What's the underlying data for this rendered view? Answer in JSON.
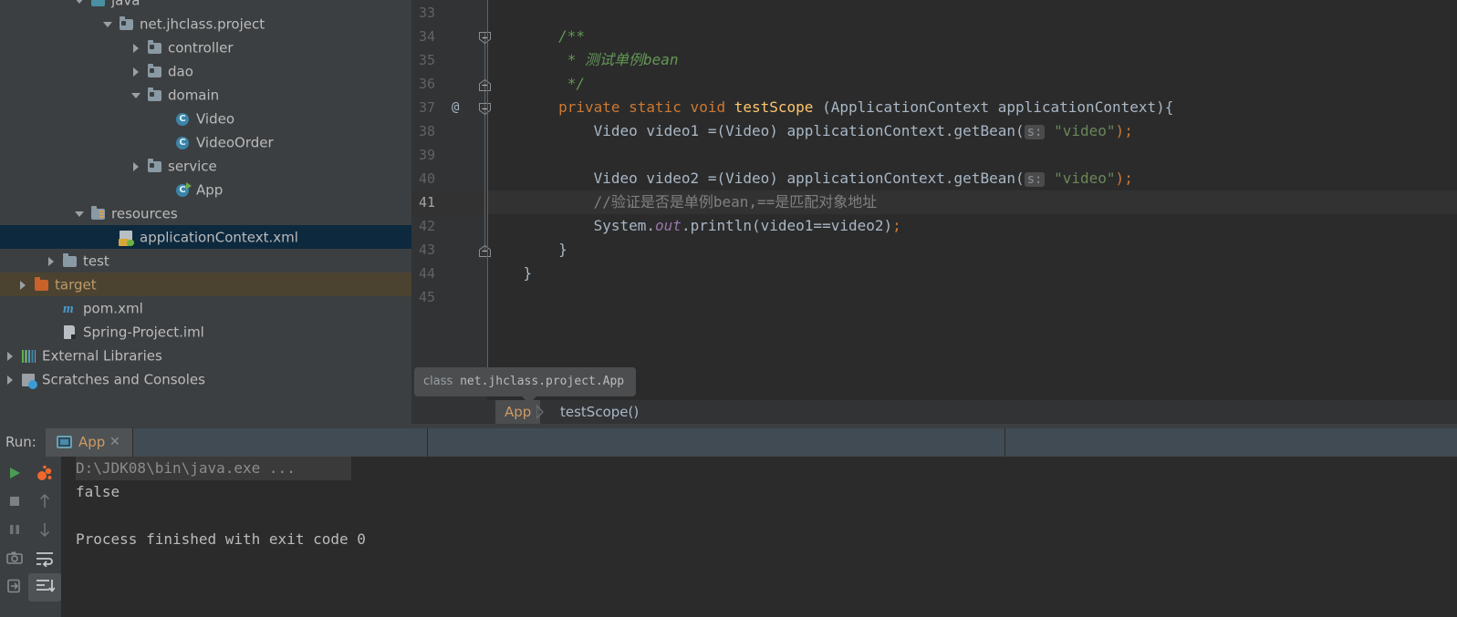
{
  "project_tree": {
    "items": [
      {
        "label": "java",
        "indent": 76,
        "arrow": "open",
        "icon": "source-folder-icon",
        "state": "normal"
      },
      {
        "label": "net.jhclass.project",
        "indent": 107,
        "arrow": "open",
        "icon": "package-folder-icon",
        "state": "normal"
      },
      {
        "label": "controller",
        "indent": 138,
        "arrow": "closed",
        "icon": "package-folder-icon",
        "state": "normal"
      },
      {
        "label": "dao",
        "indent": 138,
        "arrow": "closed",
        "icon": "package-folder-icon",
        "state": "normal"
      },
      {
        "label": "domain",
        "indent": 138,
        "arrow": "open",
        "icon": "package-folder-icon",
        "state": "normal"
      },
      {
        "label": "Video",
        "indent": 169,
        "arrow": "none",
        "icon": "class-icon",
        "state": "normal"
      },
      {
        "label": "VideoOrder",
        "indent": 169,
        "arrow": "none",
        "icon": "class-icon",
        "state": "normal"
      },
      {
        "label": "service",
        "indent": 138,
        "arrow": "closed",
        "icon": "package-folder-icon",
        "state": "normal"
      },
      {
        "label": "App",
        "indent": 169,
        "arrow": "none",
        "icon": "runnable-class-icon",
        "state": "normal"
      },
      {
        "label": "resources",
        "indent": 76,
        "arrow": "open",
        "icon": "resources-folder-icon",
        "state": "normal"
      },
      {
        "label": "applicationContext.xml",
        "indent": 107,
        "arrow": "none",
        "icon": "spring-xml-icon",
        "state": "selected"
      },
      {
        "label": "test",
        "indent": 45,
        "arrow": "closed",
        "icon": "folder-icon",
        "state": "normal"
      },
      {
        "label": "target",
        "indent": 14,
        "arrow": "closed",
        "icon": "excluded-folder-icon",
        "state": "excluded"
      },
      {
        "label": "pom.xml",
        "indent": 45,
        "arrow": "none",
        "icon": "maven-icon",
        "state": "normal"
      },
      {
        "label": "Spring-Project.iml",
        "indent": 45,
        "arrow": "none",
        "icon": "iml-icon",
        "state": "normal"
      },
      {
        "label": "External Libraries",
        "indent": 0,
        "arrow": "closed",
        "icon": "libraries-icon",
        "state": "normal"
      },
      {
        "label": "Scratches and Consoles",
        "indent": 0,
        "arrow": "closed",
        "icon": "scratches-icon",
        "state": "normal"
      }
    ]
  },
  "editor": {
    "first_line_number": 33,
    "last_line_number": 45,
    "current_line": 41,
    "gutter_annotation": "@",
    "lines": [
      {
        "num": 33,
        "html": ""
      },
      {
        "num": 34,
        "html": "        <span class=\"cmd\">/**</span>"
      },
      {
        "num": 35,
        "html": "         <span class=\"cmd\">* 测试单例bean</span>"
      },
      {
        "num": 36,
        "html": "         <span class=\"cmd\">*/</span>"
      },
      {
        "num": 37,
        "html": "        <span class=\"k\">private static void</span> <span class=\"m\">testScope</span> (ApplicationContext applicationContext){"
      },
      {
        "num": 38,
        "html": "            Video video1 =(Video) applicationContext.getBean(<span class=\"hint\">s:</span> <span class=\"s\">\"video\"</span><span class=\"k\">)</span><span class=\"k\">;</span>"
      },
      {
        "num": 39,
        "html": ""
      },
      {
        "num": 40,
        "html": "            Video video2 =(Video) applicationContext.getBean(<span class=\"hint\">s:</span> <span class=\"s\">\"video\"</span><span class=\"k\">)</span><span class=\"k\">;</span>"
      },
      {
        "num": 41,
        "html": "            <span class=\"cm\">//验证是否是单例bean,==是匹配对象地址</span>"
      },
      {
        "num": 42,
        "html": "            System.<span class=\"fi\">out</span>.println(video1==video2)<span class=\"k\">;</span>"
      },
      {
        "num": 43,
        "html": "        }"
      },
      {
        "num": 44,
        "html": "    }"
      },
      {
        "num": 45,
        "html": ""
      }
    ],
    "plain_text_lines": [
      "",
      "    /**",
      "     * 测试单例bean",
      "     */",
      "    private static void testScope (ApplicationContext applicationContext){",
      "        Video video1 =(Video) applicationContext.getBean( s: \"video\");",
      "",
      "        Video video2 =(Video) applicationContext.getBean( s: \"video\");",
      "        //验证是否是单例bean,==是匹配对象地址",
      "        System.out.println(video1==video2);",
      "    }",
      "}",
      ""
    ]
  },
  "tooltip": {
    "keyword": "class",
    "qualified_name": "net.jhclass.project.App"
  },
  "breadcrumb": {
    "items": [
      {
        "label": "App",
        "active": true
      },
      {
        "label": "testScope()",
        "active": false
      }
    ]
  },
  "run_panel": {
    "label": "Run:",
    "tab": {
      "title": "App",
      "close": "✕",
      "icon": "console-icon"
    },
    "toolbar_left": [
      {
        "name": "rerun-button",
        "icon": "play-icon"
      },
      {
        "name": "stop-button",
        "icon": "stop-icon"
      },
      {
        "name": "pause-button",
        "icon": "pause-icon"
      },
      {
        "name": "screenshot-button",
        "icon": "camera-icon"
      },
      {
        "name": "export-button",
        "icon": "export-icon"
      }
    ],
    "toolbar_right": [
      {
        "name": "toggle-tasks-button",
        "icon": "profiler-icon"
      },
      {
        "name": "up-button",
        "icon": "arrow-up-icon"
      },
      {
        "name": "down-button",
        "icon": "arrow-down-icon"
      },
      {
        "name": "soft-wrap-button",
        "icon": "soft-wrap-icon"
      },
      {
        "name": "scroll-to-end-button",
        "icon": "scroll-to-end-icon",
        "selected": true
      }
    ],
    "console": {
      "command": "D:\\JDK08\\bin\\java.exe ...",
      "output": "false",
      "blank": "",
      "exit": "Process finished with exit code 0"
    }
  },
  "colors": {
    "panel_bg": "#3c3f41",
    "editor_bg": "#2b2b2b",
    "gutter_bg": "#313335",
    "selection_bg": "#0d293e",
    "excluded_bg": "#4b4330",
    "keyword": "#cc7832",
    "method": "#ffc66d",
    "string": "#6a8759",
    "comment": "#808080",
    "doc_comment": "#629755",
    "field": "#9876aa",
    "text": "#a9b7c6",
    "tab_active": "#4e5254",
    "tab_bar": "#414b53",
    "tab_label": "#cc9a64"
  }
}
